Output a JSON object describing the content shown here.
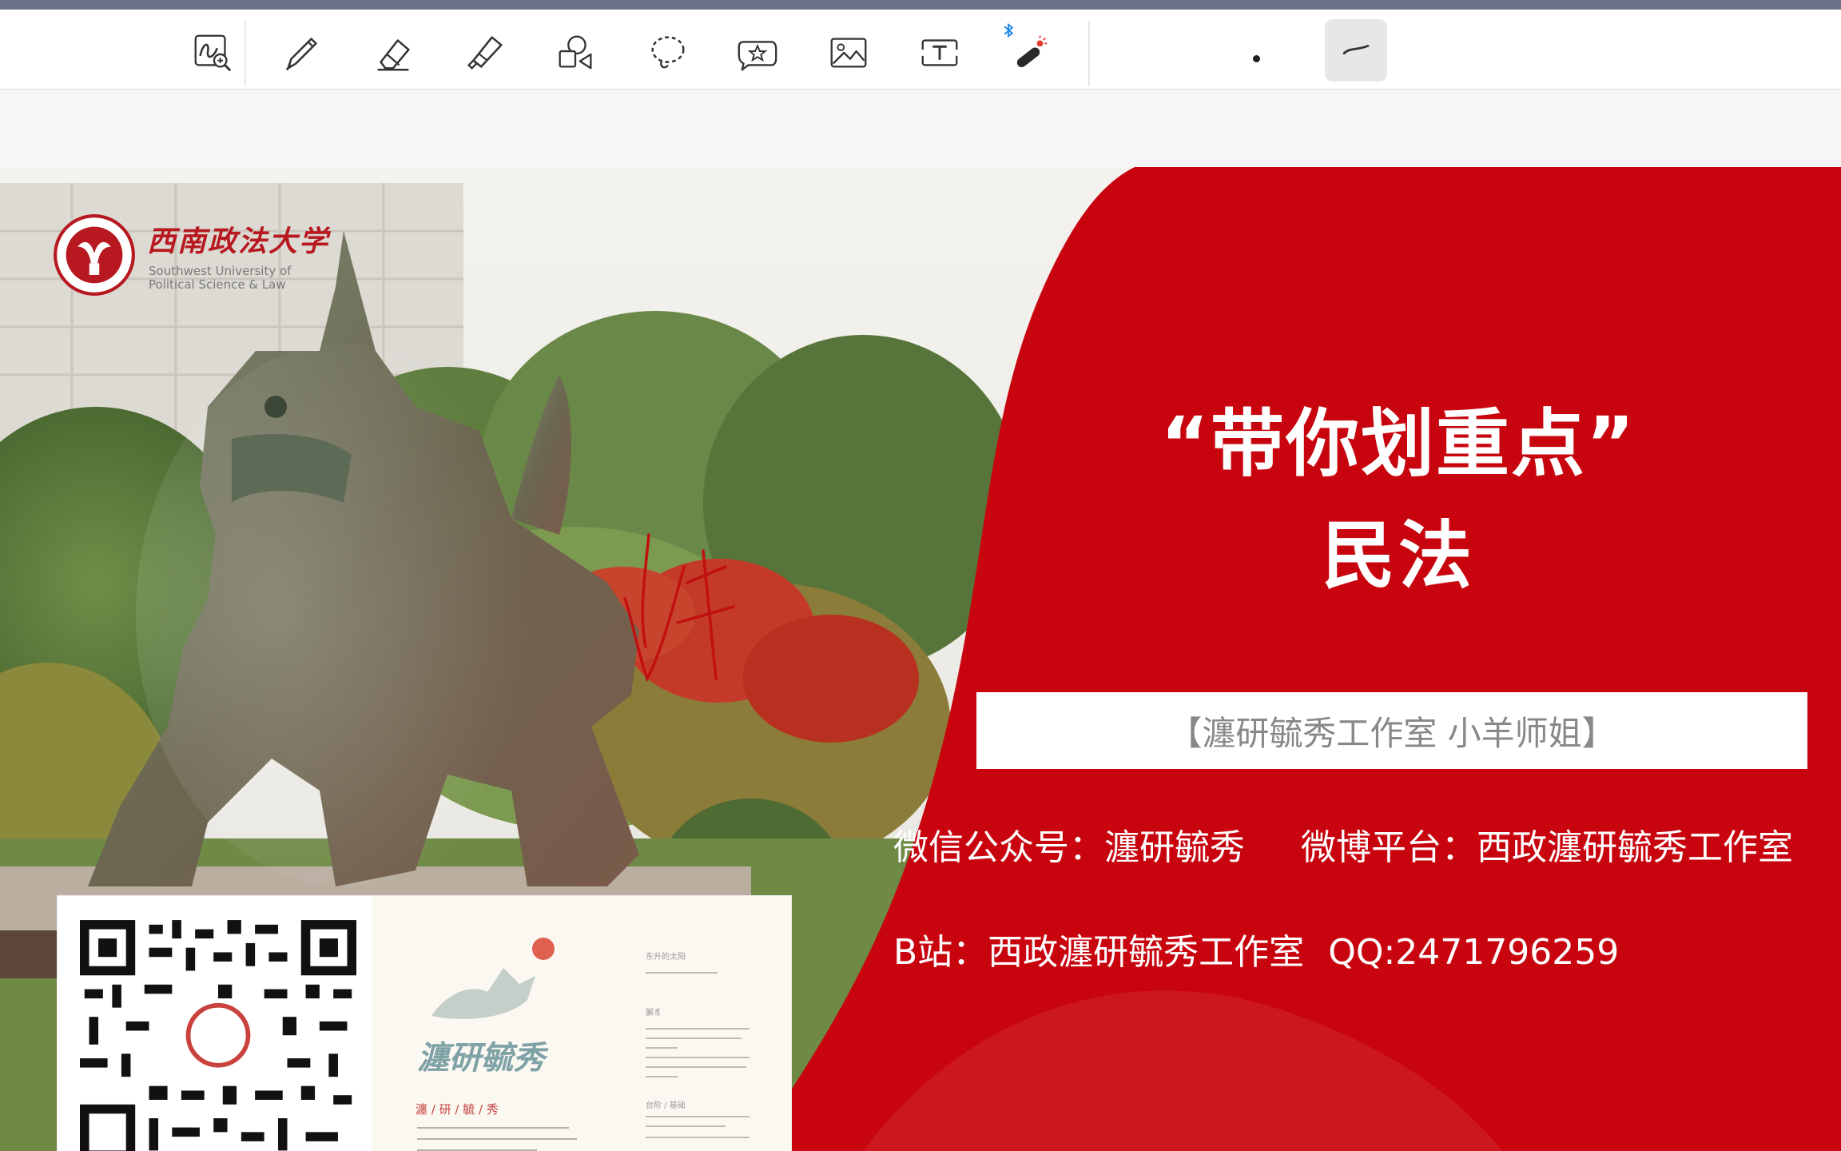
{
  "toolbar": {
    "tools": [
      {
        "name": "lasso-zoom-tool",
        "icon": "zoom-sketch-icon"
      },
      {
        "name": "pen-tool",
        "icon": "pen-icon"
      },
      {
        "name": "eraser-tool",
        "icon": "eraser-icon"
      },
      {
        "name": "highlighter-tool",
        "icon": "highlighter-icon"
      },
      {
        "name": "shapes-tool",
        "icon": "shapes-icon"
      },
      {
        "name": "lasso-tool",
        "icon": "lasso-icon"
      },
      {
        "name": "sticker-tool",
        "icon": "sticker-star-icon"
      },
      {
        "name": "image-tool",
        "icon": "image-icon"
      },
      {
        "name": "text-tool",
        "icon": "text-box-icon"
      },
      {
        "name": "laser-pointer-tool",
        "icon": "laser-pointer-icon",
        "badge_icon": "bluetooth-icon"
      }
    ],
    "selected_stroke": "curve-stroke-icon"
  },
  "slide": {
    "logo": {
      "name_cn": "西南政法大学",
      "name_en_line1": "Southwest University of",
      "name_en_line2": "Political Science & Law"
    },
    "title_line1": "“带你划重点”",
    "title_line2": "民法",
    "studio_label": "【瀍研毓秀工作室   小羊师姐】",
    "info_wechat": "微信公众号：瀍研毓秀",
    "info_weibo": "微博平台：西政瀍研毓秀工作室",
    "info_bilibili": "B站：西政瀍研毓秀工作室",
    "info_qq": "QQ:2471796259",
    "poster": {
      "title": "瀍研毓秀",
      "subtitle": "瀍 / 研 / 毓 / 秀",
      "note_1": "东升的太阳",
      "note_2": "獬豸",
      "note_3": "台阶 / 基础"
    }
  },
  "colors": {
    "accent_red": "#c8050f",
    "toolbar_bg": "#ffffff",
    "window_strip": "#6b7187",
    "ink": "#c01010"
  }
}
